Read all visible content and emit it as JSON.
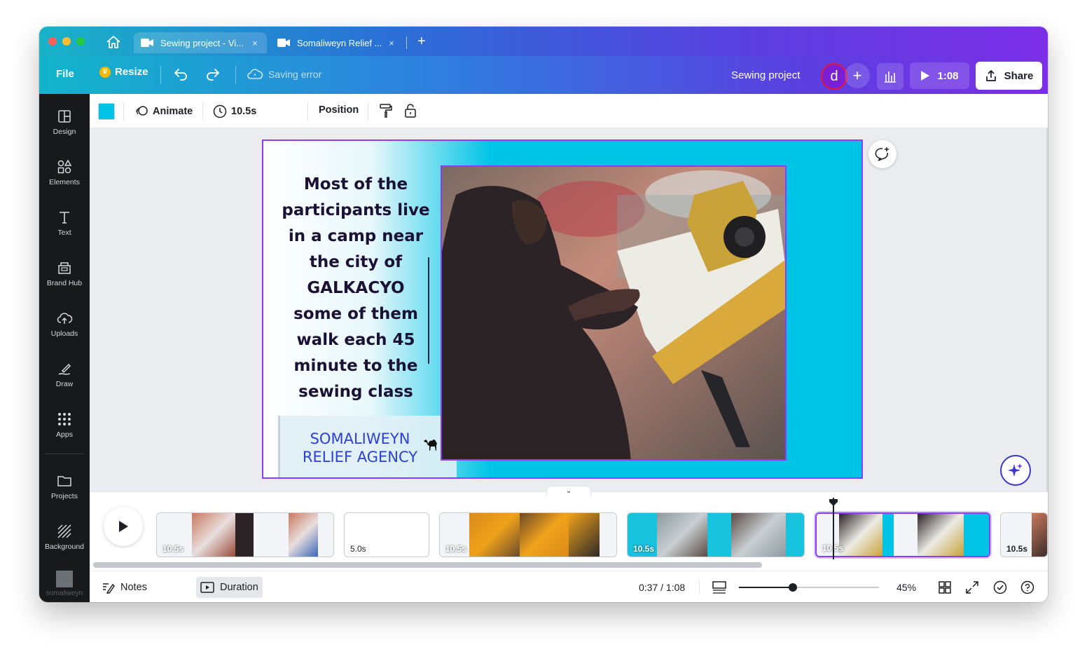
{
  "browser": {
    "tabs": [
      {
        "label": "Sewing project - Vi...",
        "close": "×"
      },
      {
        "label": "Somaliweyn Relief ...",
        "close": "×"
      }
    ],
    "new_tab": "+"
  },
  "topbar": {
    "file": "File",
    "resize": "Resize",
    "saving_status": "Saving error",
    "project_name": "Sewing project",
    "avatar_initial": "d",
    "add_collaborator": "+",
    "play_duration": "1:08",
    "share": "Share"
  },
  "sidebar": {
    "items": [
      {
        "label": "Design",
        "icon": "design-icon"
      },
      {
        "label": "Elements",
        "icon": "elements-icon"
      },
      {
        "label": "Text",
        "icon": "text-icon"
      },
      {
        "label": "Brand Hub",
        "icon": "brand-hub-icon"
      },
      {
        "label": "Uploads",
        "icon": "uploads-icon"
      },
      {
        "label": "Draw",
        "icon": "draw-icon"
      },
      {
        "label": "Apps",
        "icon": "apps-icon"
      },
      {
        "label": "Projects",
        "icon": "folder-icon"
      },
      {
        "label": "Background",
        "icon": "background-icon"
      }
    ],
    "account_label": "somaliweyn"
  },
  "context_toolbar": {
    "color": "#00c4e6",
    "animate": "Animate",
    "duration": "10.5s",
    "position": "Position"
  },
  "slide": {
    "text_lines": [
      "Most of the",
      "participants live",
      "in a camp near",
      "the city of",
      "GALKACYO",
      "some of them",
      "walk each 45",
      "minute to the",
      "sewing class"
    ],
    "logo_line1": "SOMALIWEYN",
    "logo_line2": "RELIEF AGENCY",
    "accent": "#00c4e6"
  },
  "timeline": {
    "clips": [
      {
        "duration": "10.5s"
      },
      {
        "duration": "5.0s"
      },
      {
        "duration": "10.5s"
      },
      {
        "duration": "10.5s"
      },
      {
        "duration": "10.5s",
        "selected": true
      },
      {
        "duration": "10.5s"
      }
    ]
  },
  "bottombar": {
    "notes": "Notes",
    "duration": "Duration",
    "time": "0:37 / 1:08",
    "zoom": "45%",
    "zoom_level": 0.45
  }
}
